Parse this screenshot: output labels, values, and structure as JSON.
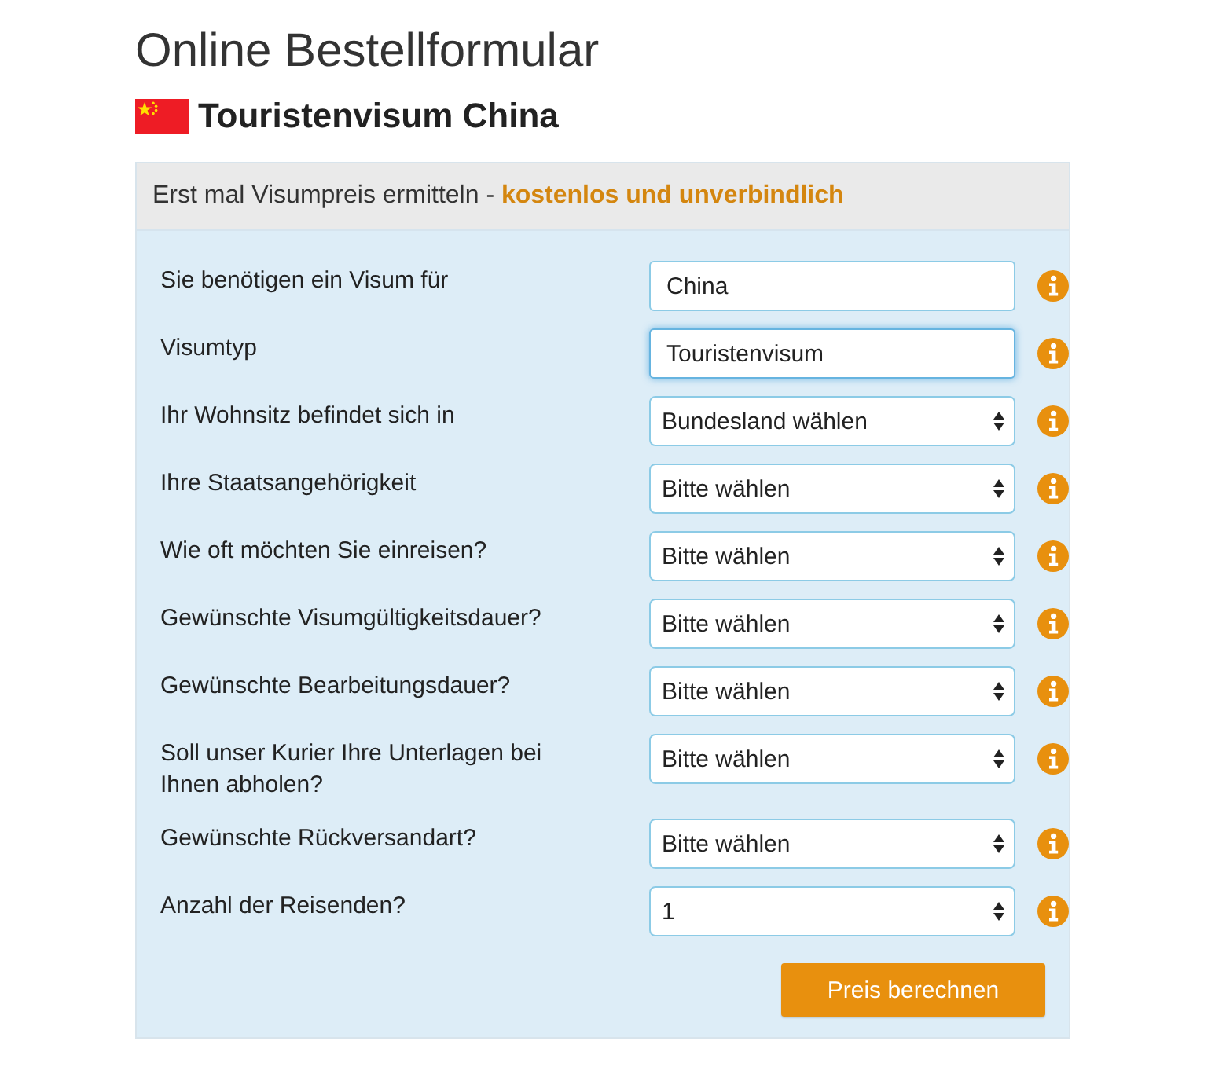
{
  "page": {
    "title": "Online Bestellformular",
    "subtitle": "Touristenvisum China"
  },
  "panel": {
    "header": "Erst mal Visumpreis ermitteln - **kostenlos und unverbindlich**",
    "fields": [
      {
        "kind": "text",
        "label": "Sie benötigen ein Visum für",
        "value": "China",
        "focused": false
      },
      {
        "kind": "text",
        "label": "Visumtyp",
        "value": "Touristenvisum",
        "focused": true
      },
      {
        "kind": "select",
        "label": "Ihr Wohnsitz befindet sich in",
        "value": "Bundesland wählen"
      },
      {
        "kind": "select",
        "label": "Ihre Staatsangehörigkeit",
        "value": "Bitte wählen"
      },
      {
        "kind": "select",
        "label": "Wie oft möchten Sie einreisen?",
        "value": "Bitte wählen"
      },
      {
        "kind": "select",
        "label": "Gewünschte Visumgültigkeitsdauer?",
        "value": "Bitte wählen"
      },
      {
        "kind": "select",
        "label": "Gewünschte Bearbeitungsdauer?",
        "value": "Bitte wählen"
      },
      {
        "kind": "select",
        "label": "Soll unser Kurier Ihre Unterlagen bei Ihnen abholen?",
        "value": "Bitte wählen"
      },
      {
        "kind": "select",
        "label": "Gewünschte Rückversandart?",
        "value": "Bitte wählen"
      },
      {
        "kind": "select",
        "label": "Anzahl der Reisenden?",
        "value": "1"
      }
    ],
    "button": "Preis berechnen"
  }
}
